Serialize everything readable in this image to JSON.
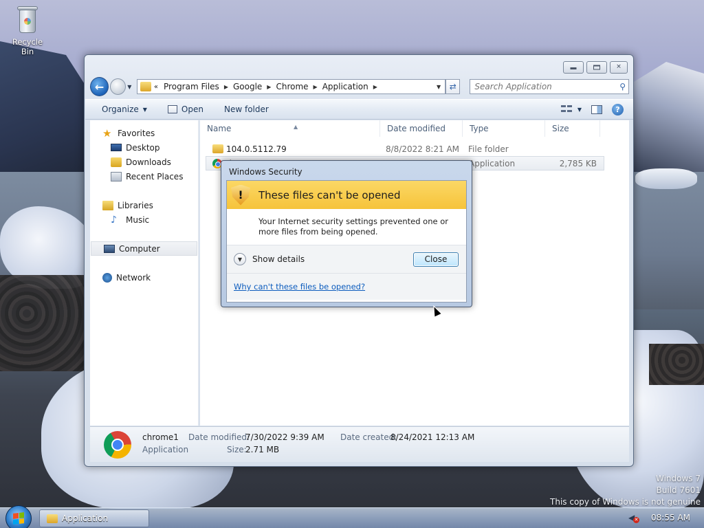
{
  "desktop": {
    "recycle_bin_label": "Recycle Bin",
    "watermark": {
      "line1": "Windows 7",
      "line2": "Build 7601",
      "line3": "This copy of Windows is not genuine"
    }
  },
  "explorer": {
    "breadcrumb": [
      "Program Files",
      "Google",
      "Chrome",
      "Application"
    ],
    "search_placeholder": "Search Application",
    "toolbar": {
      "organize": "Organize",
      "open": "Open",
      "new_folder": "New folder"
    },
    "nav": {
      "favorites": "Favorites",
      "desktop": "Desktop",
      "downloads": "Downloads",
      "recent_places": "Recent Places",
      "libraries": "Libraries",
      "music": "Music",
      "computer": "Computer",
      "network": "Network"
    },
    "columns": {
      "name": "Name",
      "date_modified": "Date modified",
      "type": "Type",
      "size": "Size"
    },
    "rows": [
      {
        "name": "104.0.5112.79",
        "date": "8/8/2022 8:21 AM",
        "type": "File folder",
        "size": ""
      },
      {
        "name": "chrome1",
        "date": "",
        "type": "Application",
        "size": "2,785 KB"
      }
    ],
    "details": {
      "name": "chrome1",
      "type": "Application",
      "date_modified_label": "Date modified:",
      "date_modified": "7/30/2022 9:39 AM",
      "date_created_label": "Date created:",
      "date_created": "8/24/2021 12:13 AM",
      "size_label": "Size:",
      "size": "2.71 MB"
    }
  },
  "dialog": {
    "title": "Windows Security",
    "heading": "These files can't be opened",
    "message": "Your Internet security settings prevented one or more files from being opened.",
    "show_details": "Show details",
    "close_label": "Close",
    "help_link": "Why can't these files be opened?"
  },
  "taskbar": {
    "task_label": "Application",
    "clock": "08:55 AM"
  },
  "colors": {
    "dialog_band": "#f6c33a",
    "link": "#0b5bbd",
    "accent": "#1e63b8"
  }
}
